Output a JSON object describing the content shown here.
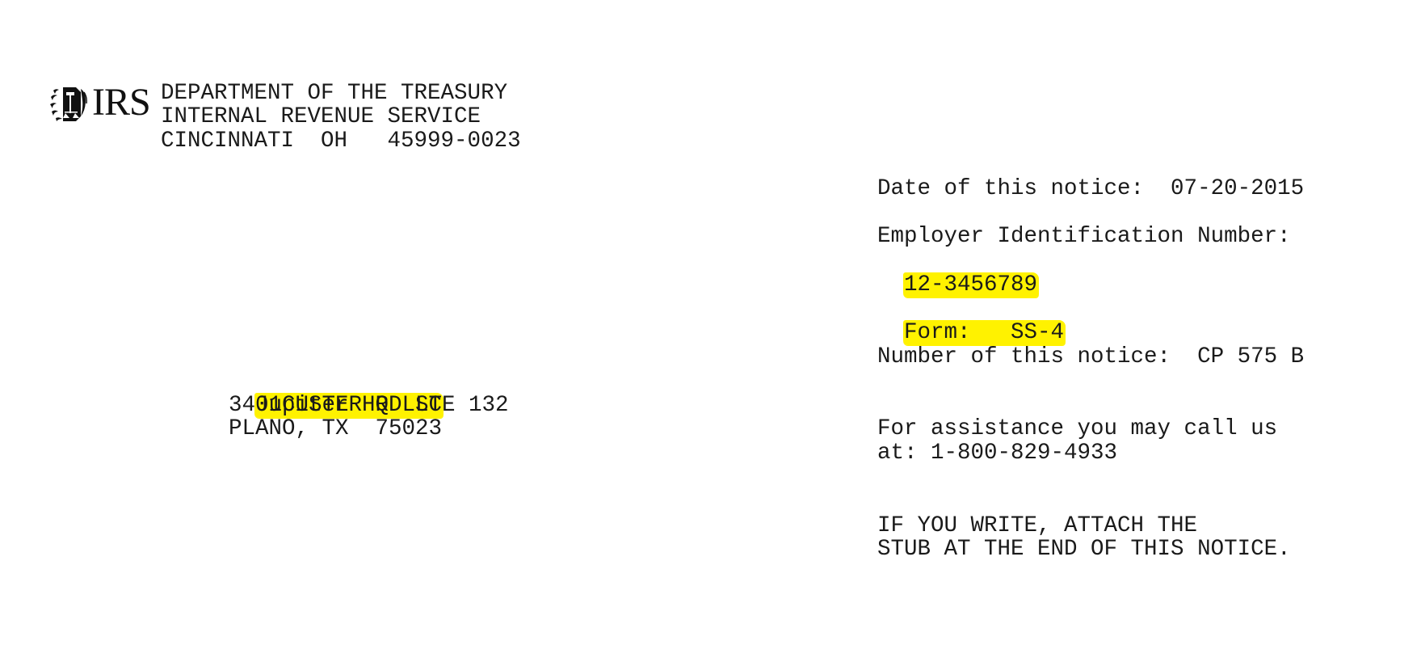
{
  "header": {
    "logo_text": "IRS",
    "logo_icon": "irs-eagle-icon",
    "agency_line1": "DEPARTMENT OF THE TREASURY",
    "agency_line2": "INTERNAL REVENUE SERVICE",
    "agency_line3": "CINCINNATI  OH   45999-0023"
  },
  "notice": {
    "date_line": "Date of this notice:  07-20-2015",
    "ein_label": "Employer Identification Number:",
    "ein_value": "12-3456789",
    "form_line": "Form:   SS-4",
    "number_line": "Number of this notice:  CP 575 B",
    "assistance_line1": "For assistance you may call us",
    "assistance_line2": "at: 1-800-829-4933",
    "write_line1": "IF YOU WRITE, ATTACH THE",
    "write_line2": "STUB AT THE END OF THIS NOTICE."
  },
  "recipient": {
    "name": "Jupiter HQ LLC",
    "street": "3401CUSTER RD STE 132",
    "city_state_zip": "PLANO, TX  75023"
  },
  "colors": {
    "highlight": "#fff200",
    "text": "#1a1a1a"
  }
}
